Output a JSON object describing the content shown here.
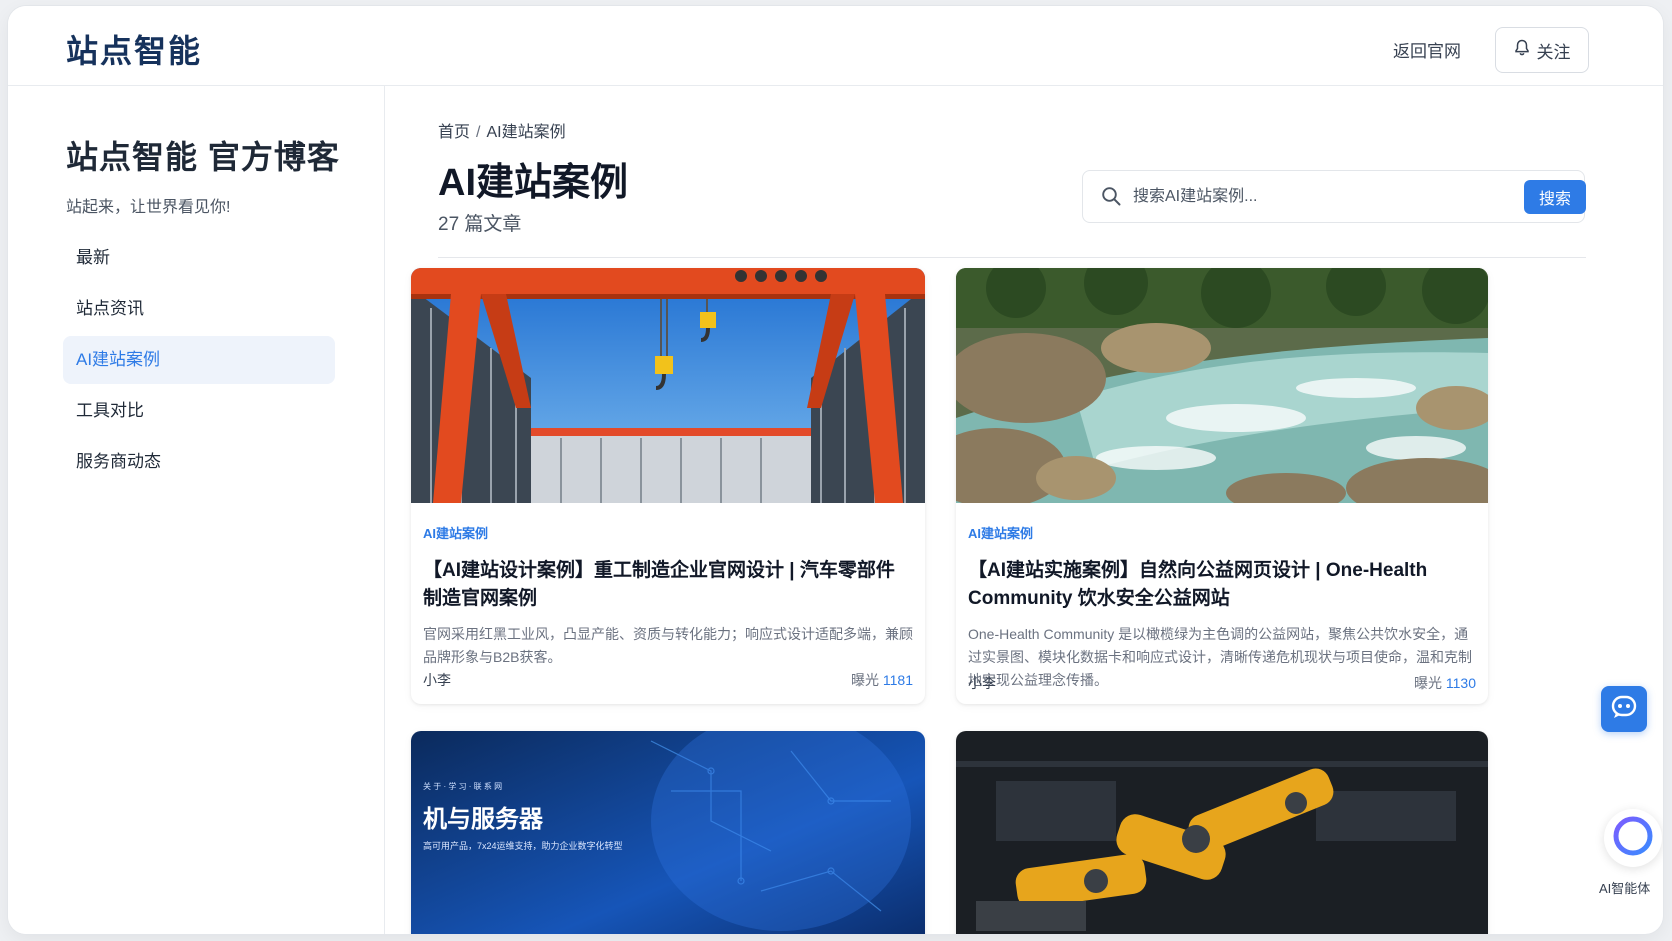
{
  "header": {
    "logo": "站点智能",
    "back_link": "返回官网",
    "follow_label": "关注"
  },
  "sidebar": {
    "blog_title": "站点智能 官方博客",
    "blog_subtitle": "站起来，让世界看见你!",
    "items": [
      {
        "label": "最新",
        "active": false
      },
      {
        "label": "站点资讯",
        "active": false
      },
      {
        "label": "AI建站案例",
        "active": true
      },
      {
        "label": "工具对比",
        "active": false
      },
      {
        "label": "服务商动态",
        "active": false
      }
    ]
  },
  "main": {
    "breadcrumb": {
      "home": "首页",
      "separator": "/",
      "current": "AI建站案例"
    },
    "title": "AI建站案例",
    "count": "27 篇文章",
    "search": {
      "placeholder": "搜索AI建站案例...",
      "button": "搜索"
    }
  },
  "cards": [
    {
      "category": "AI建站案例",
      "title": "【AI建站设计案例】重工制造企业官网设计 | 汽车零部件制造官网案例",
      "desc": "官网采用红黑工业风，凸显产能、资质与转化能力；响应式设计适配多端，兼顾品牌形象与B2B获客。",
      "author": "小李",
      "views_label": "曝光",
      "views": "1181",
      "image": "industrial-crane"
    },
    {
      "category": "AI建站案例",
      "title": "【AI建站实施案例】自然向公益网页设计 | One-Health Community 饮水安全公益网站",
      "desc": "One-Health Community 是以橄榄绿为主色调的公益网站，聚焦公共饮水安全，通过实景图、模块化数据卡和响应式设计，清晰传递危机现状与项目使命，温和克制地实现公益理念传播。",
      "author": "小李",
      "views_label": "曝光",
      "views": "1130",
      "image": "river-rocks"
    },
    {
      "image": "tech-servers",
      "overlay_small": "关 于 · 学 习 · 联 系 网",
      "overlay_title": "机与服务器",
      "overlay_sub": "高可用产品，7x24运维支持，助力企业数字化转型"
    },
    {
      "image": "robot-arm"
    }
  ],
  "floating": {
    "chat_icon": "chat-bubble-icon",
    "ai_label": "AI智能体"
  },
  "colors": {
    "accent": "#2e7be6",
    "logo": "#16325c",
    "active_bg": "#eef3fb"
  }
}
